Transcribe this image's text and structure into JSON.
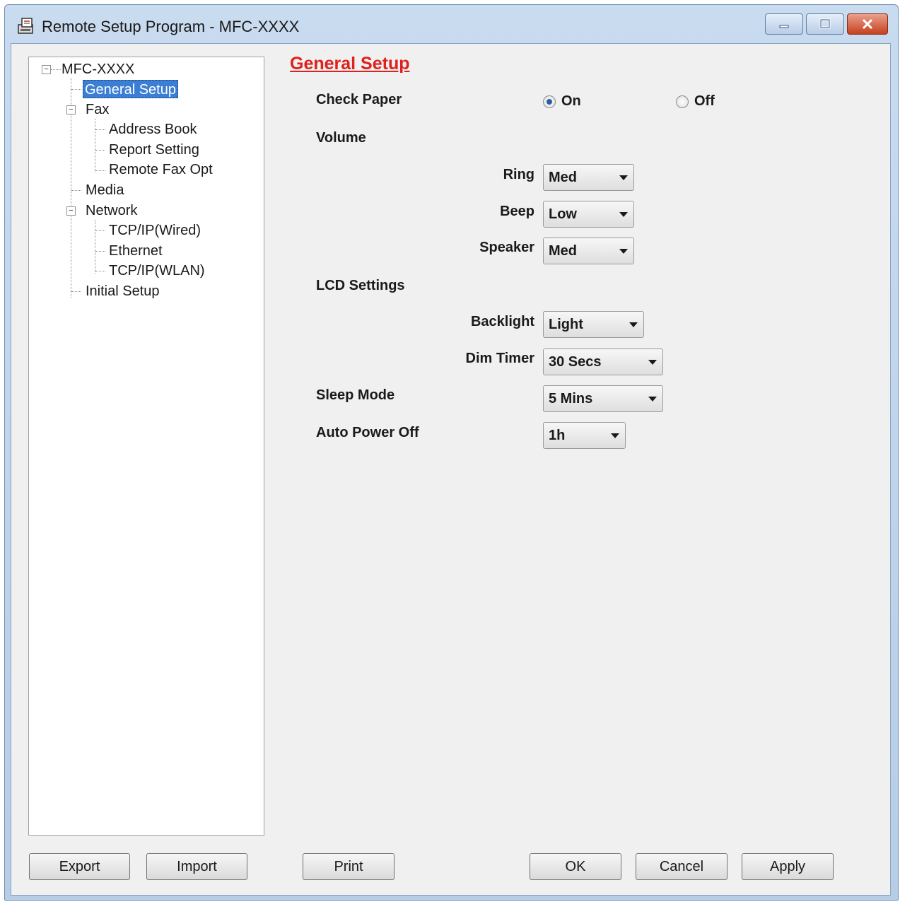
{
  "window": {
    "title": "Remote Setup Program - MFC-XXXX"
  },
  "tree": {
    "root": "MFC-XXXX",
    "items": [
      {
        "label": "General Setup",
        "selected": true
      },
      {
        "label": "Fax"
      },
      {
        "label": "Address Book"
      },
      {
        "label": "Report Setting"
      },
      {
        "label": "Remote Fax Opt"
      },
      {
        "label": "Media"
      },
      {
        "label": "Network"
      },
      {
        "label": "TCP/IP(Wired)"
      },
      {
        "label": "Ethernet"
      },
      {
        "label": "TCP/IP(WLAN)"
      },
      {
        "label": "Initial Setup"
      }
    ]
  },
  "panel": {
    "title": "General Setup",
    "check_paper": {
      "label": "Check Paper",
      "on": "On",
      "off": "Off",
      "selected": "On"
    },
    "volume": {
      "label": "Volume",
      "ring": {
        "label": "Ring",
        "value": "Med"
      },
      "beep": {
        "label": "Beep",
        "value": "Low"
      },
      "speaker": {
        "label": "Speaker",
        "value": "Med"
      }
    },
    "lcd": {
      "label": "LCD Settings",
      "backlight": {
        "label": "Backlight",
        "value": "Light"
      },
      "dim_timer": {
        "label": "Dim Timer",
        "value": "30 Secs"
      }
    },
    "sleep_mode": {
      "label": "Sleep Mode",
      "value": "5 Mins"
    },
    "auto_power_off": {
      "label": "Auto Power Off",
      "value": "1h"
    }
  },
  "buttons": {
    "export": "Export",
    "import": "Import",
    "print": "Print",
    "ok": "OK",
    "cancel": "Cancel",
    "apply": "Apply"
  }
}
